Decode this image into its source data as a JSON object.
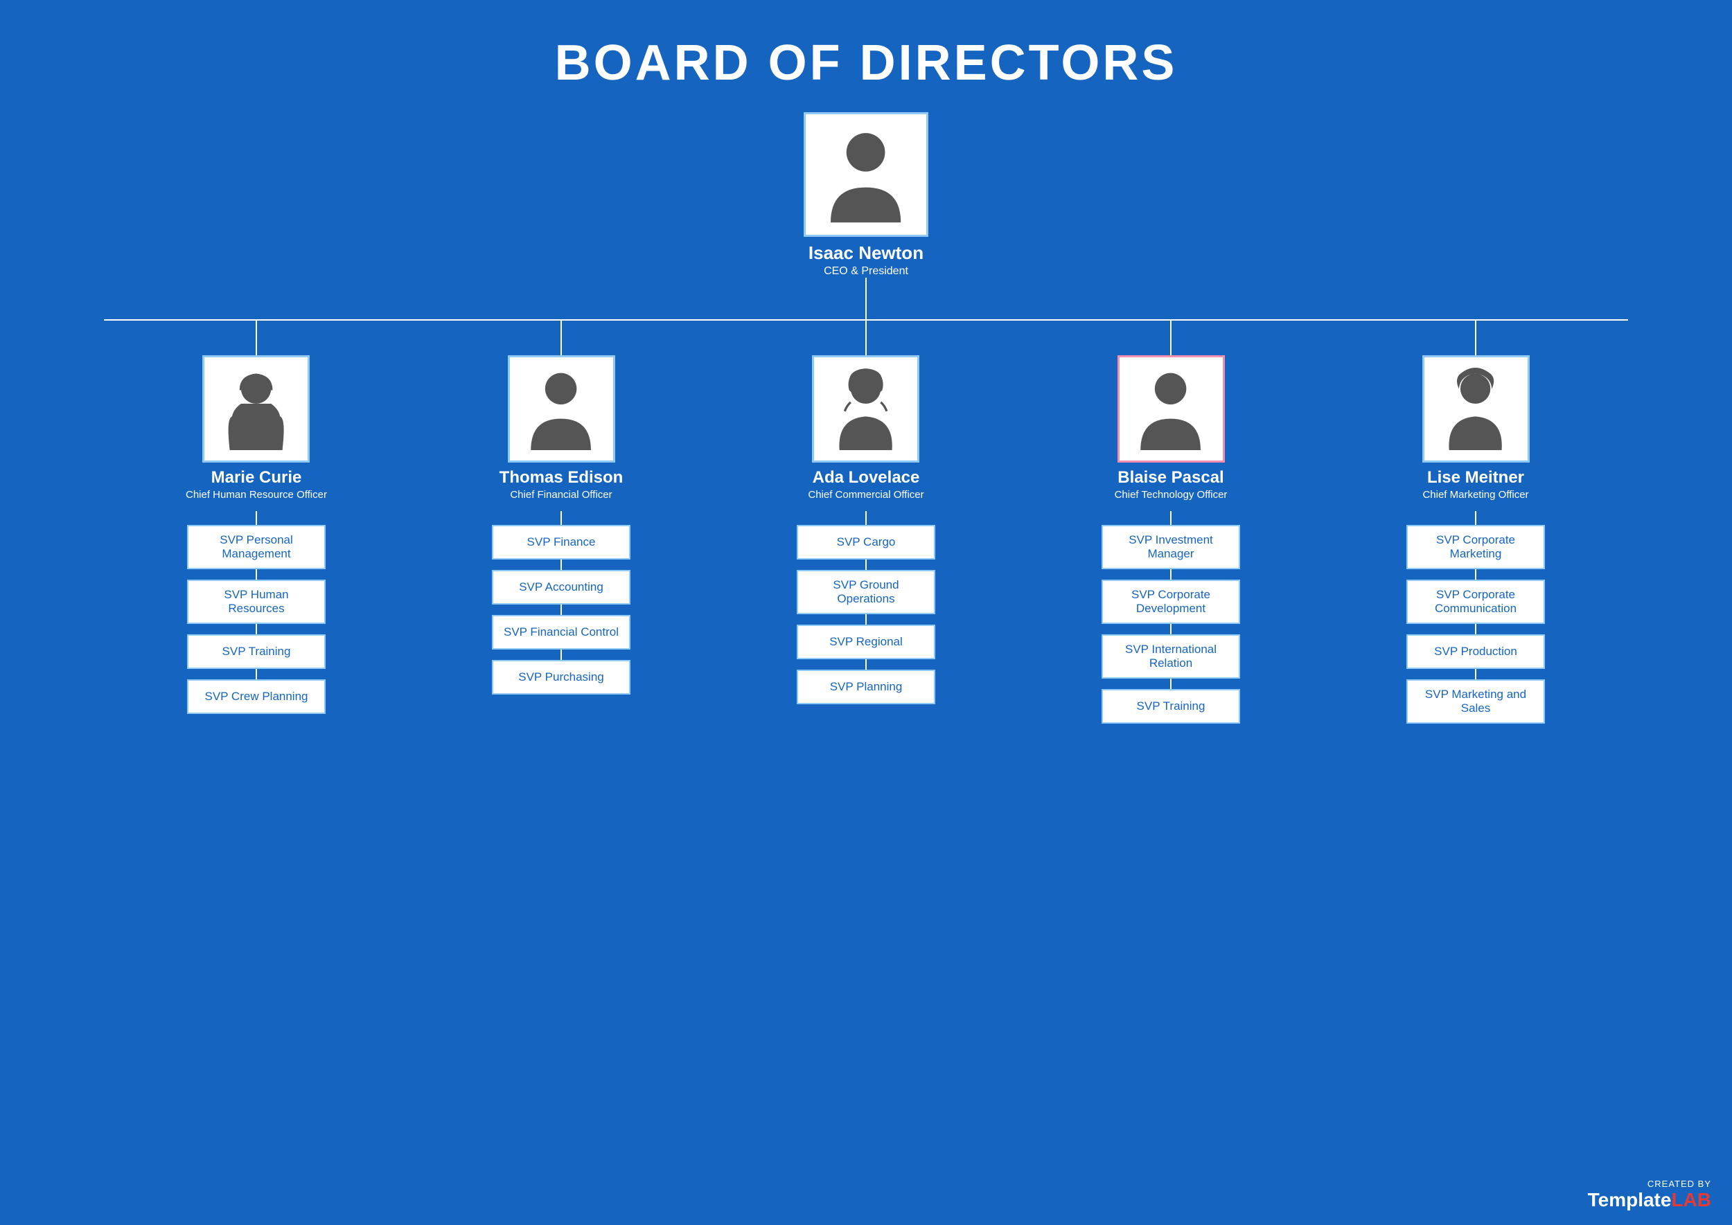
{
  "title": "BOARD OF DIRECTORS",
  "ceo": {
    "name": "Isaac Newton",
    "title": "CEO & President"
  },
  "directors": [
    {
      "name": "Marie Curie",
      "title": "Chief Human Resource Officer",
      "gender": "female",
      "svp": [
        "SVP Personal Management",
        "SVP Human Resources",
        "SVP Training",
        "SVP Crew Planning"
      ]
    },
    {
      "name": "Thomas Edison",
      "title": "Chief Financial Officer",
      "gender": "male",
      "svp": [
        "SVP Finance",
        "SVP Accounting",
        "SVP Financial Control",
        "SVP Purchasing"
      ]
    },
    {
      "name": "Ada Lovelace",
      "title": "Chief Commercial Officer",
      "gender": "female",
      "svp": [
        "SVP Cargo",
        "SVP Ground Operations",
        "SVP Regional",
        "SVP Planning"
      ]
    },
    {
      "name": "Blaise Pascal",
      "title": "Chief Technology Officer",
      "gender": "male",
      "svp": [
        "SVP Investment Manager",
        "SVP Corporate Development",
        "SVP International Relation",
        "SVP Training"
      ]
    },
    {
      "name": "Lise Meitner",
      "title": "Chief Marketing Officer",
      "gender": "female",
      "svp": [
        "SVP Corporate Marketing",
        "SVP Corporate Communication",
        "SVP Production",
        "SVP Marketing and Sales"
      ]
    }
  ],
  "watermark": {
    "created_by": "CREATED BY",
    "brand_template": "Template",
    "brand_lab": "LAB"
  },
  "colors": {
    "background": "#1565C0",
    "card_border": "#90CAF9",
    "white": "#FFFFFF",
    "svp_text": "#1565C0",
    "red": "#E53935"
  }
}
